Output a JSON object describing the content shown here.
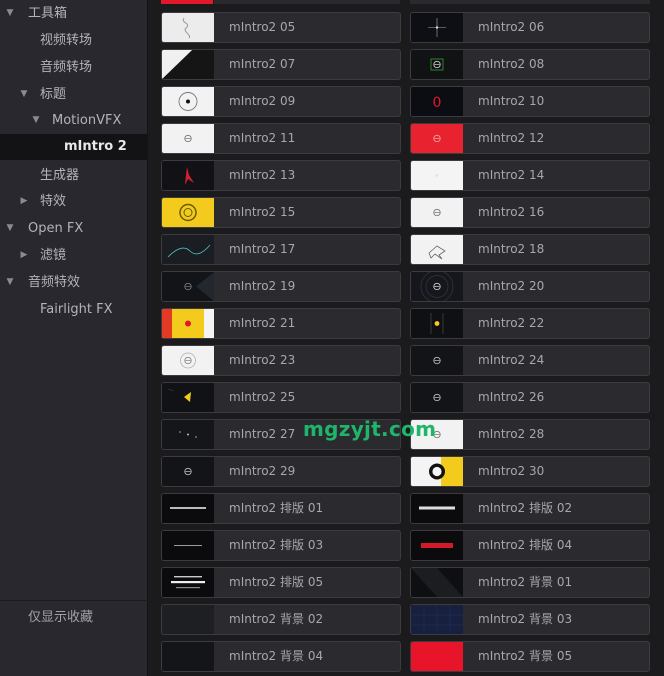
{
  "sidebar": {
    "items": [
      {
        "label": "工具箱"
      },
      {
        "label": "视频转场"
      },
      {
        "label": "音频转场"
      },
      {
        "label": "标题"
      },
      {
        "label": "MotionVFX"
      },
      {
        "label": "mIntro 2"
      },
      {
        "label": "生成器"
      },
      {
        "label": "特效"
      },
      {
        "label": "Open FX"
      },
      {
        "label": "滤镜"
      },
      {
        "label": "音频特效"
      },
      {
        "label": "Fairlight FX"
      }
    ],
    "favorites_only": "仅显示收藏"
  },
  "tiles": [
    {
      "label": "mIntro2 05",
      "thumb": "white-doodle"
    },
    {
      "label": "mIntro2 06",
      "thumb": "dark-star"
    },
    {
      "label": "mIntro2 07",
      "thumb": "white-diagonal"
    },
    {
      "label": "mIntro2 08",
      "thumb": "dark-square"
    },
    {
      "label": "mIntro2 09",
      "thumb": "white-ring"
    },
    {
      "label": "mIntro2 10",
      "thumb": "dark-red-zero"
    },
    {
      "label": "mIntro2 11",
      "thumb": "white-logo"
    },
    {
      "label": "mIntro2 12",
      "thumb": "red-logo"
    },
    {
      "label": "mIntro2 13",
      "thumb": "dark-red-spike"
    },
    {
      "label": "mIntro2 14",
      "thumb": "white-blank"
    },
    {
      "label": "mIntro2 15",
      "thumb": "yellow-logo"
    },
    {
      "label": "mIntro2 16",
      "thumb": "white-logo"
    },
    {
      "label": "mIntro2 17",
      "thumb": "dark-wave"
    },
    {
      "label": "mIntro2 18",
      "thumb": "white-splash"
    },
    {
      "label": "mIntro2 19",
      "thumb": "dark-mixed"
    },
    {
      "label": "mIntro2 20",
      "thumb": "dark-circles"
    },
    {
      "label": "mIntro2 21",
      "thumb": "yellow-red"
    },
    {
      "label": "mIntro2 22",
      "thumb": "dark-yellow-dot"
    },
    {
      "label": "mIntro2 23",
      "thumb": "white-circle-logo"
    },
    {
      "label": "mIntro2 24",
      "thumb": "dark-logo"
    },
    {
      "label": "mIntro2 25",
      "thumb": "dark-yellow-tri"
    },
    {
      "label": "mIntro2 26",
      "thumb": "dark-logo"
    },
    {
      "label": "mIntro2 27",
      "thumb": "dark-dots"
    },
    {
      "label": "mIntro2 28",
      "thumb": "white-logo"
    },
    {
      "label": "mIntro2 29",
      "thumb": "dark-logo"
    },
    {
      "label": "mIntro2 30",
      "thumb": "yellow-circle"
    },
    {
      "label": "mIntro2 排版 01",
      "thumb": "dark-text"
    },
    {
      "label": "mIntro2 排版 02",
      "thumb": "dark-text-bold"
    },
    {
      "label": "mIntro2 排版 03",
      "thumb": "dark-text-thin"
    },
    {
      "label": "mIntro2 排版 04",
      "thumb": "dark-red-bar"
    },
    {
      "label": "mIntro2 排版 05",
      "thumb": "dark-text-block"
    },
    {
      "label": "mIntro2 背景 01",
      "thumb": "dark-diagonal"
    },
    {
      "label": "mIntro2 背景 02",
      "thumb": "dark-plain"
    },
    {
      "label": "mIntro2 背景 03",
      "thumb": "navy-grid"
    },
    {
      "label": "mIntro2 背景 04",
      "thumb": "dark-plain2"
    },
    {
      "label": "mIntro2 背景 05",
      "thumb": "red-plain"
    }
  ],
  "watermark": "mgzyjt.com",
  "colors": {
    "accent_red": "#e0182a",
    "accent_yellow": "#f2cb1d",
    "watermark_green": "#1fb56a"
  }
}
